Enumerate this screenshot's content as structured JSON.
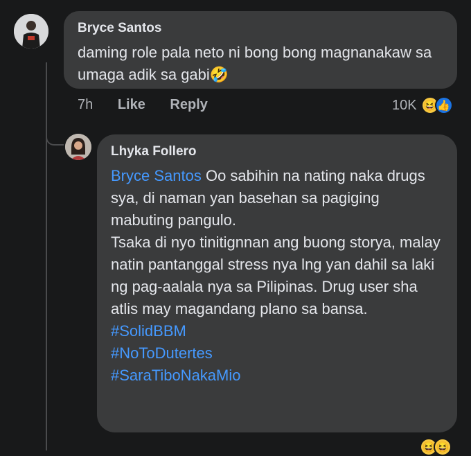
{
  "comment": {
    "author": "Bryce Santos",
    "text": "daming role pala neto ni bong bong magnanakaw sa umaga adik sa gabi",
    "emoji": "🤣",
    "time": "7h",
    "like_label": "Like",
    "reply_label": "Reply",
    "reaction_count": "10K"
  },
  "reply": {
    "author": "Lhyka Follero",
    "mention": "Bryce Santos",
    "text_after_mention": " Oo sabihin na nating naka drugs sya, di naman yan basehan sa pagiging mabuting pangulo.",
    "paragraph2": "Tsaka di nyo tinitignnan ang buong storya, malay natin pantanggal stress nya lng yan dahil sa laki ng pag-aalala nya sa Pilipinas. Drug user sha atlis may magandang plano sa bansa.",
    "hashtags": [
      "#SolidBBM",
      "#NoToDutertes",
      "#SaraTiboNakaMio"
    ]
  },
  "icons": {
    "haha": "😆",
    "like": "👍"
  }
}
